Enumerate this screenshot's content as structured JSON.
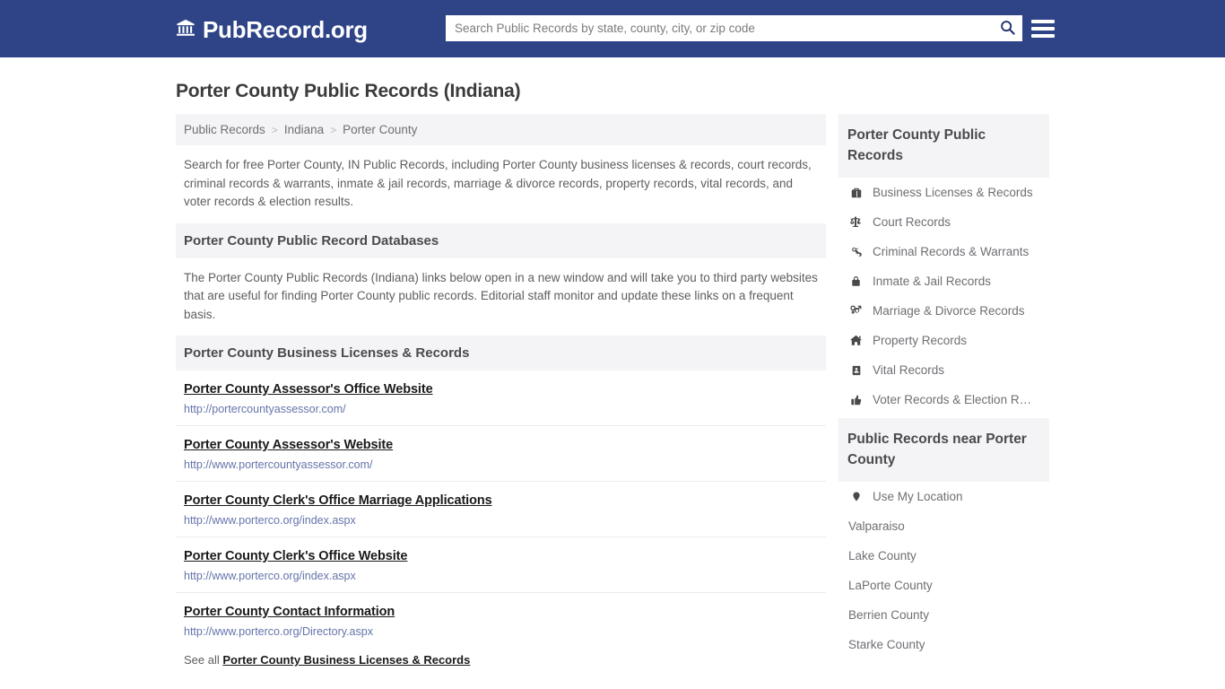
{
  "brand": {
    "name": "PubRecord.org",
    "icon": "bank-icon",
    "header_color": "#2e4487"
  },
  "search": {
    "placeholder": "Search Public Records by state, county, city, or zip code",
    "value": "",
    "search_icon": "search-icon",
    "menu_icon": "hamburger-menu-icon"
  },
  "page_title": "Porter County Public Records (Indiana)",
  "breadcrumb": {
    "items": [
      "Public Records",
      "Indiana",
      "Porter County"
    ],
    "separator": ">"
  },
  "intro": "Search for free Porter County, IN Public Records, including Porter County business licenses & records, court records, criminal records & warrants, inmate & jail records, marriage & divorce records, property records, vital records, and voter records & election results.",
  "databases_section": {
    "heading": "Porter County Public Record Databases",
    "paragraph": "The Porter County Public Records (Indiana) links below open in a new window and will take you to third party websites that are useful for finding Porter County public records. Editorial staff monitor and update these links on a frequent basis."
  },
  "business_section": {
    "heading": "Porter County Business Licenses & Records",
    "links": [
      {
        "title": "Porter County Assessor's Office Website",
        "url": "http://portercountyassessor.com/"
      },
      {
        "title": "Porter County Assessor's Website",
        "url": "http://www.portercountyassessor.com/"
      },
      {
        "title": "Porter County Clerk's Office Marriage Applications",
        "url": "http://www.porterco.org/index.aspx"
      },
      {
        "title": "Porter County Clerk's Office Website",
        "url": "http://www.porterco.org/index.aspx"
      },
      {
        "title": "Porter County Contact Information",
        "url": "http://www.porterco.org/Directory.aspx"
      }
    ],
    "see_all_prefix": "See all",
    "see_all_link": "Porter County Business Licenses & Records"
  },
  "sidebar": {
    "records_card": {
      "heading": "Porter County Public Records",
      "items": [
        {
          "label": "Business Licenses & Records",
          "icon": "briefcase-icon"
        },
        {
          "label": "Court Records",
          "icon": "scales-of-justice-icon"
        },
        {
          "label": "Criminal Records & Warrants",
          "icon": "handcuffs-icon"
        },
        {
          "label": "Inmate & Jail Records",
          "icon": "lock-icon"
        },
        {
          "label": "Marriage & Divorce Records",
          "icon": "venus-mars-icon"
        },
        {
          "label": "Property Records",
          "icon": "home-icon"
        },
        {
          "label": "Vital Records",
          "icon": "id-badge-icon"
        },
        {
          "label": "Voter Records & Election R…",
          "icon": "thumbs-up-icon"
        }
      ]
    },
    "near_card": {
      "heading": "Public Records near Porter County",
      "items": [
        {
          "label": "Use My Location",
          "icon": "map-pin-icon"
        },
        {
          "label": "Valparaiso",
          "icon": ""
        },
        {
          "label": "Lake County",
          "icon": ""
        },
        {
          "label": "LaPorte County",
          "icon": ""
        },
        {
          "label": "Berrien County",
          "icon": ""
        },
        {
          "label": "Starke County",
          "icon": ""
        }
      ]
    }
  }
}
